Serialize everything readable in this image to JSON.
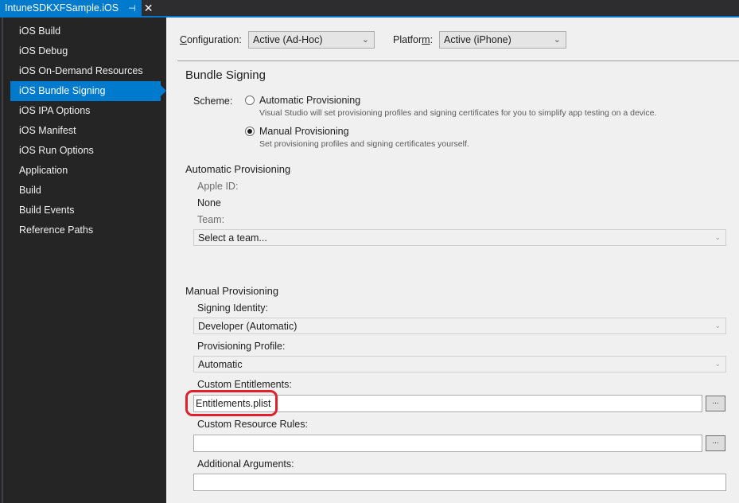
{
  "tab": {
    "title": "IntuneSDKXFSample.iOS",
    "pin_icon": "pin-icon",
    "close_icon": "close-icon"
  },
  "sidebar": {
    "items": [
      {
        "label": "iOS Build",
        "active": false
      },
      {
        "label": "iOS Debug",
        "active": false
      },
      {
        "label": "iOS On-Demand Resources",
        "active": false
      },
      {
        "label": "iOS Bundle Signing",
        "active": true
      },
      {
        "label": "iOS IPA Options",
        "active": false
      },
      {
        "label": "iOS Manifest",
        "active": false
      },
      {
        "label": "iOS Run Options",
        "active": false
      },
      {
        "label": "Application",
        "active": false
      },
      {
        "label": "Build",
        "active": false
      },
      {
        "label": "Build Events",
        "active": false
      },
      {
        "label": "Reference Paths",
        "active": false
      }
    ]
  },
  "toolbar": {
    "configuration_label_accel": "C",
    "configuration_label_rest": "onfiguration:",
    "configuration_value": "Active (Ad-Hoc)",
    "platform_label_pre": "Platfor",
    "platform_label_accel": "m",
    "platform_label_post": ":",
    "platform_value": "Active (iPhone)"
  },
  "page": {
    "title": "Bundle Signing",
    "scheme_label": "Scheme:",
    "scheme_options": [
      {
        "label": "Automatic Provisioning",
        "description": "Visual Studio will set provisioning profiles and signing certificates for you to simplify app testing on a device.",
        "checked": false
      },
      {
        "label": "Manual Provisioning",
        "description": "Set provisioning profiles and signing certificates yourself.",
        "checked": true
      }
    ]
  },
  "automatic": {
    "heading": "Automatic Provisioning",
    "apple_id_label": "Apple ID:",
    "apple_id_value": "None",
    "team_label": "Team:",
    "team_placeholder": "Select a team..."
  },
  "manual": {
    "heading": "Manual Provisioning",
    "signing_identity_label": "Signing Identity:",
    "signing_identity_value": "Developer (Automatic)",
    "provisioning_profile_label": "Provisioning Profile:",
    "provisioning_profile_value": "Automatic",
    "custom_entitlements_label": "Custom Entitlements:",
    "custom_entitlements_value": "Entitlements.plist",
    "custom_resource_rules_label": "Custom Resource Rules:",
    "custom_resource_rules_value": "",
    "additional_arguments_label": "Additional Arguments:",
    "additional_arguments_value": "",
    "browse_label": "..."
  },
  "colors": {
    "accent": "#007acc",
    "sidebar_bg": "#252526",
    "content_bg": "#f0f0f0",
    "highlight": "#e0202b"
  }
}
